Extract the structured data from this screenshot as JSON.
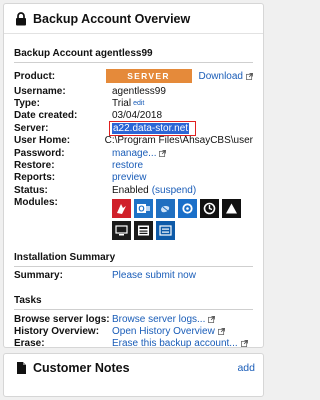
{
  "overview": {
    "title": "Backup Account Overview",
    "account_heading": "Backup Account agentless99",
    "product_label": "Product:",
    "product_badge": "SERVER",
    "download_link": "Download",
    "username_label": "Username:",
    "username": "agentless99",
    "type_label": "Type:",
    "type": "Trial",
    "type_edit": "edit",
    "date_created_label": "Date created:",
    "date_created": "03/04/2018",
    "server_label": "Server:",
    "server": "a22.data-stor.net",
    "user_home_label": "User Home:",
    "user_home": "C:\\Program Files\\AhsayCBS\\user",
    "password_label": "Password:",
    "password_link": "manage...",
    "restore_label": "Restore:",
    "restore_link": "restore",
    "reports_label": "Reports:",
    "reports_link": "preview",
    "status_label": "Status:",
    "status": "Enabled",
    "status_suspend": "(suspend)",
    "modules_label": "Modules:",
    "modules": [
      "cloud-file-backup-icon",
      "exchange-outlook-icon",
      "ms-sql-icon",
      "exchange-mailbox-icon",
      "windows-backup-icon",
      "continuous-protection-icon",
      "hyper-v-icon",
      "mysql-icon",
      "nas-icon"
    ]
  },
  "installation": {
    "title": "Installation Summary",
    "summary_label": "Summary:",
    "summary_link": "Please submit now"
  },
  "tasks": {
    "title": "Tasks",
    "browse_label": "Browse server logs:",
    "browse_link": "Browse server logs...",
    "history_label": "History Overview:",
    "history_link": "Open History Overview",
    "erase_label": "Erase:",
    "erase_link": "Erase this backup account..."
  },
  "notes": {
    "title": "Customer Notes",
    "add_link": "add"
  },
  "colors": {
    "accent_link": "#1a5db8",
    "server_badge": "#e58a3a",
    "highlight_border": "#e02020",
    "selection": "#2b65d6"
  }
}
